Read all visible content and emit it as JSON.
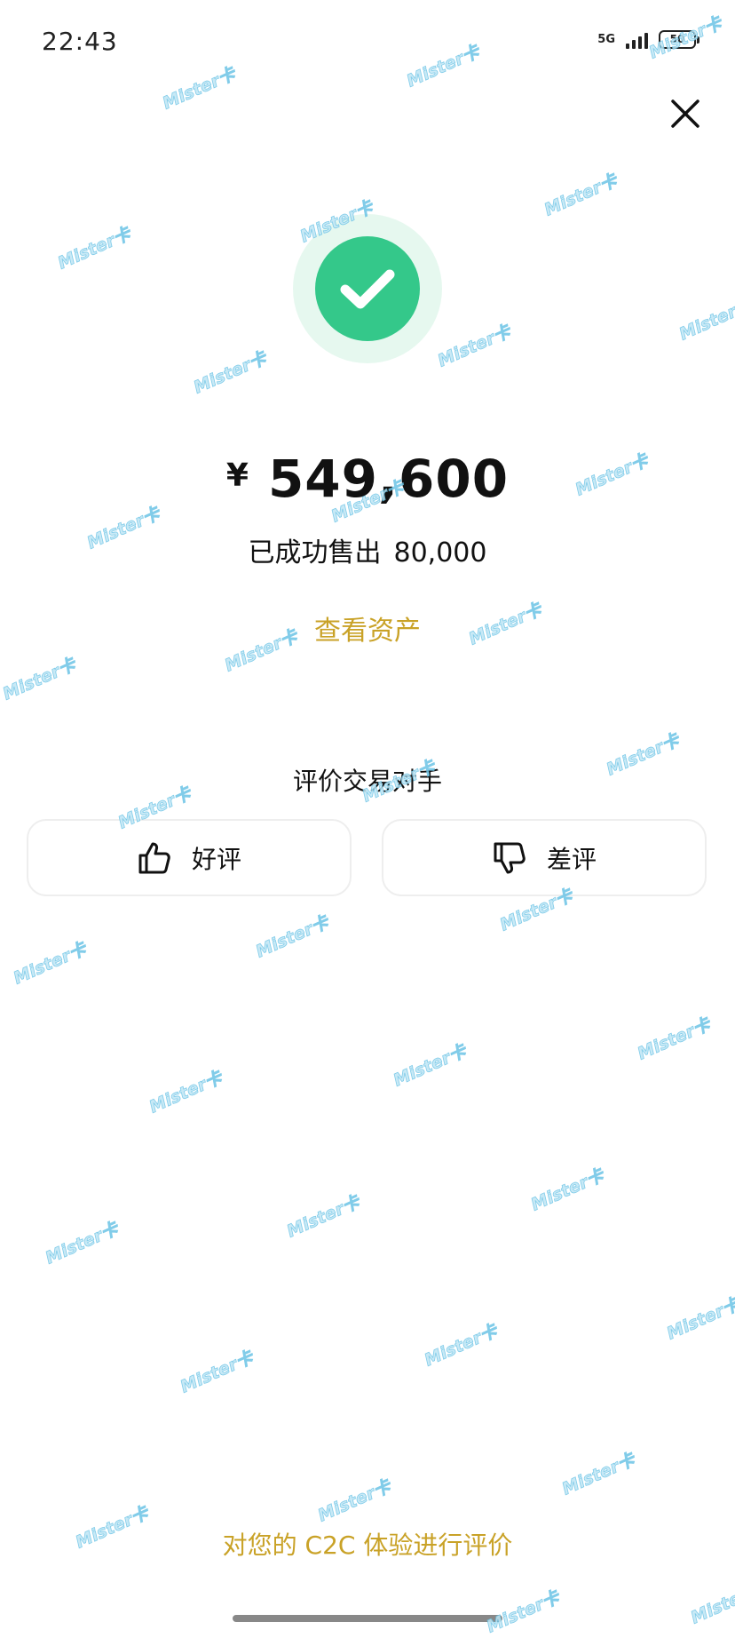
{
  "status_bar": {
    "time": "22:43",
    "network": "5G",
    "battery": "50"
  },
  "result": {
    "currency_symbol": "¥",
    "amount": "549,600",
    "sold_label": "已成功售出",
    "sold_quantity": "80,000",
    "view_assets_label": "查看资产"
  },
  "rating": {
    "title": "评价交易对手",
    "positive_label": "好评",
    "negative_label": "差评"
  },
  "footer": {
    "feedback_label": "对您的 C2C 体验进行评价"
  },
  "watermark": {
    "text": "Mister卡"
  },
  "colors": {
    "success": "#34c88a",
    "accent_gold": "#c9a227",
    "watermark": "#6cc4e6"
  },
  "icons": [
    "close-icon",
    "checkmark-icon",
    "thumbs-up-icon",
    "thumbs-down-icon"
  ]
}
